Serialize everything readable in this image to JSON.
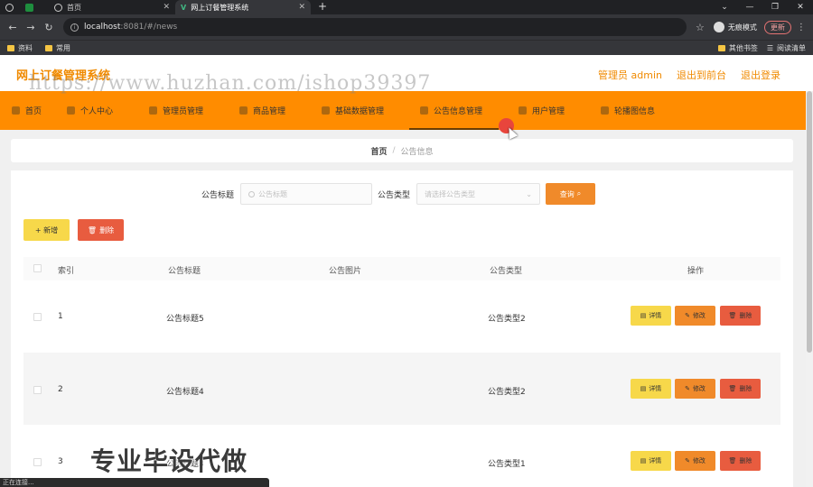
{
  "browser": {
    "tabs": [
      {
        "label": ""
      },
      {
        "label": "首页"
      },
      {
        "label": "网上订餐管理系统"
      }
    ],
    "url_host": "localhost",
    "url_rest": ":8081/#/news",
    "incognito_label": "无痕模式",
    "update_label": "更新",
    "bookmarks": [
      "资料",
      "常用"
    ],
    "bookmarks_right": [
      "其他书签",
      "阅读清单"
    ]
  },
  "header": {
    "title": "网上订餐管理系统",
    "user": "管理员 admin",
    "back_front": "退出到前台",
    "logout": "退出登录"
  },
  "watermark": "https://www.huzhan.com/ishop39397",
  "menu": [
    {
      "label": "首页"
    },
    {
      "label": "个人中心"
    },
    {
      "label": "管理员管理"
    },
    {
      "label": "商品管理"
    },
    {
      "label": "基础数据管理"
    },
    {
      "label": "公告信息管理"
    },
    {
      "label": "用户管理"
    },
    {
      "label": "轮播图信息"
    }
  ],
  "breadcrumb": {
    "home": "首页",
    "sep": "/",
    "current": "公告信息"
  },
  "search": {
    "title_label": "公告标题",
    "title_placeholder": "公告标题",
    "type_label": "公告类型",
    "type_placeholder": "请选择公告类型",
    "query_label": "查询"
  },
  "actions": {
    "add": "+ 新增",
    "delete": "删除"
  },
  "table": {
    "headers": [
      "索引",
      "公告标题",
      "公告图片",
      "公告类型",
      "操作"
    ],
    "rows": [
      {
        "index": "1",
        "title": "公告标题5",
        "type": "公告类型2"
      },
      {
        "index": "2",
        "title": "公告标题4",
        "type": "公告类型2"
      },
      {
        "index": "3",
        "title": "公告标题3",
        "type": "公告类型1"
      }
    ],
    "op_labels": {
      "detail": "详情",
      "edit": "修改",
      "remove": "删除"
    }
  },
  "overlay_text": "专业毕设代做",
  "status_text": "正在连接..."
}
